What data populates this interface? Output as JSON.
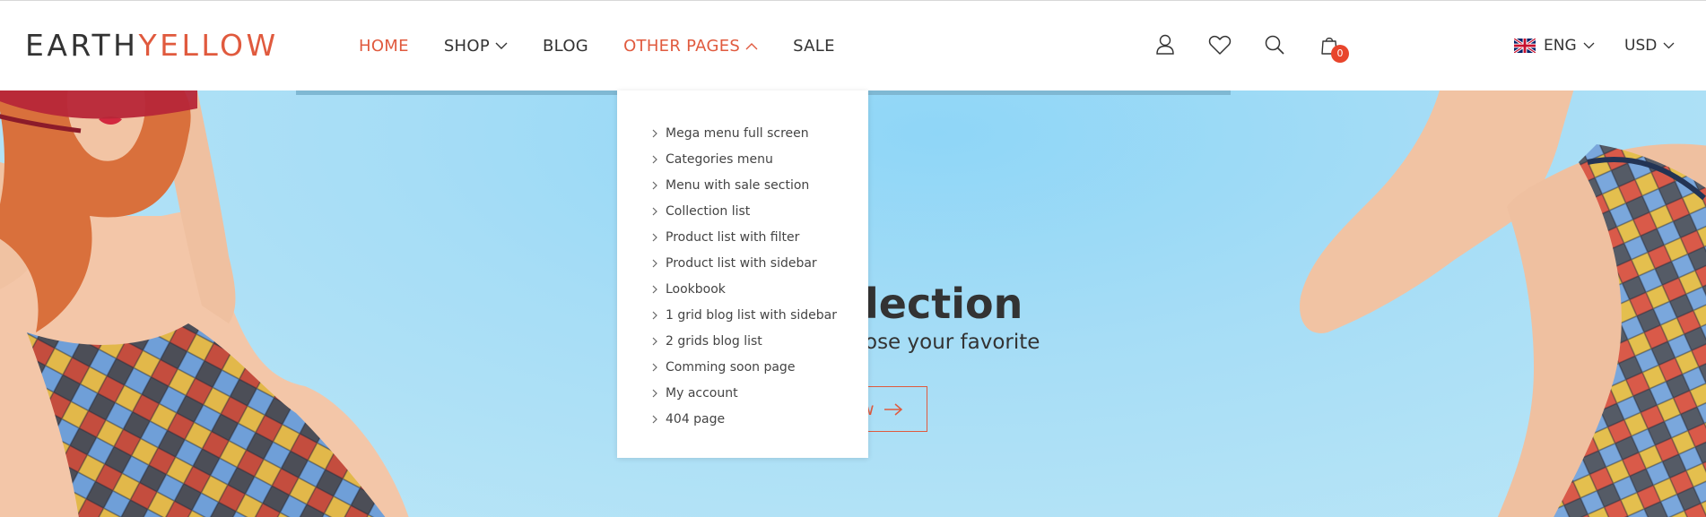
{
  "brand": {
    "part1": "EARTH",
    "part2": "YELLOW"
  },
  "nav": {
    "home": "HOME",
    "shop": "SHOP",
    "blog": "BLOG",
    "other_pages": "OTHER PAGES",
    "sale": "SALE"
  },
  "header_icons": [
    "user-icon",
    "heart-icon",
    "search-icon",
    "shopping-bag-icon"
  ],
  "cart": {
    "count": "0"
  },
  "language": {
    "flag": "uk-flag-icon",
    "label": "ENG"
  },
  "currency": {
    "label": "USD"
  },
  "dropdown": {
    "items": [
      "Mega menu full screen",
      "Categories menu",
      "Menu with sale section",
      "Collection list",
      "Product list with filter",
      "Product list with sidebar",
      "Lookbook",
      "1 grid blog list with sidebar",
      "2 grids blog list",
      "Comming soon page",
      "My account",
      "404 page"
    ]
  },
  "hero": {
    "title": "lection",
    "subtitle": "ose your favorite",
    "button": "w"
  },
  "colors": {
    "accent": "#e05a3e",
    "text": "#333333",
    "badge": "#e8452c",
    "hero_bg": "#a6ddf6"
  }
}
